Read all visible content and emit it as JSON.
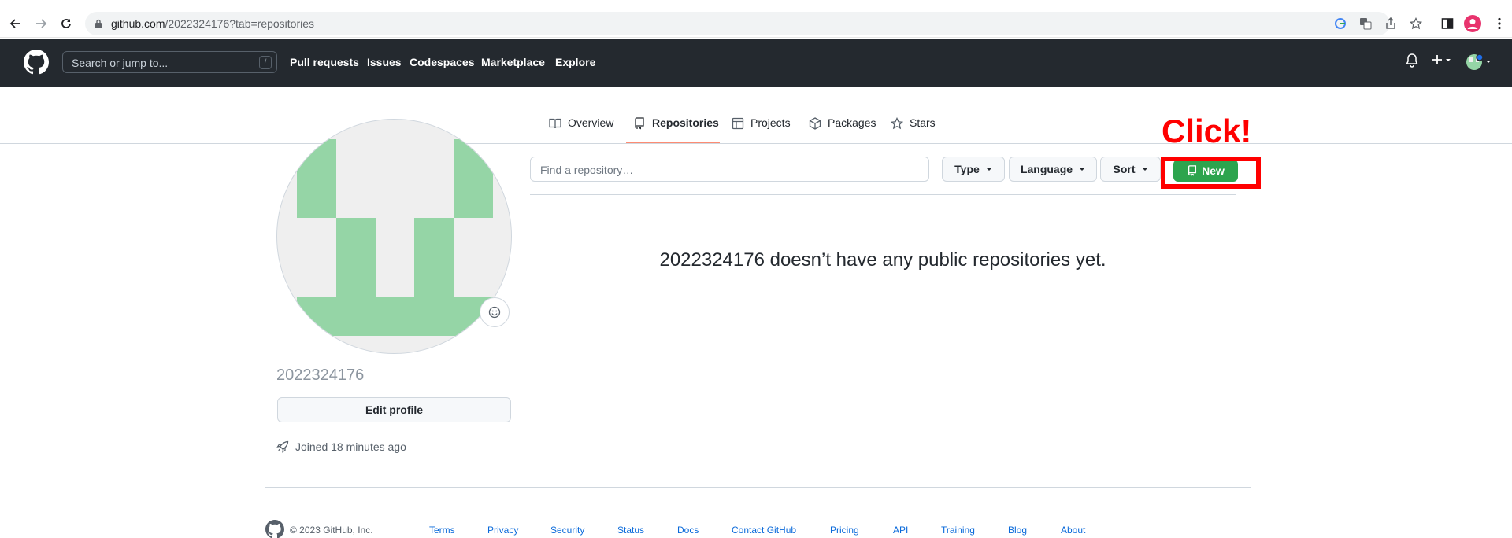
{
  "browser": {
    "url_host": "github.com",
    "url_path": "/2022324176?tab=repositories"
  },
  "header": {
    "search_placeholder": "Search or jump to...",
    "search_shortcut": "/",
    "nav": [
      "Pull requests",
      "Issues",
      "Codespaces",
      "Marketplace",
      "Explore"
    ]
  },
  "tabs": [
    {
      "label": "Overview",
      "icon": "book-icon"
    },
    {
      "label": "Repositories",
      "icon": "repo-icon",
      "active": true
    },
    {
      "label": "Projects",
      "icon": "table-icon"
    },
    {
      "label": "Packages",
      "icon": "package-icon"
    },
    {
      "label": "Stars",
      "icon": "star-icon"
    }
  ],
  "profile": {
    "username": "2022324176",
    "edit_label": "Edit profile",
    "joined": "Joined 18 minutes ago"
  },
  "repos": {
    "find_placeholder": "Find a repository…",
    "type_label": "Type",
    "language_label": "Language",
    "sort_label": "Sort",
    "new_label": "New",
    "empty_message": "2022324176 doesn’t have any public repositories yet."
  },
  "annotation": {
    "click_label": "Click!",
    "color": "#ff0000"
  },
  "footer": {
    "copyright": "© 2023 GitHub, Inc.",
    "links": [
      "Terms",
      "Privacy",
      "Security",
      "Status",
      "Docs",
      "Contact GitHub",
      "Pricing",
      "API",
      "Training",
      "Blog",
      "About"
    ]
  },
  "colors": {
    "header_bg": "#24292f",
    "new_button": "#2da44e",
    "tab_underline": "#fd8c73",
    "avatar_green": "#95d5a6"
  }
}
